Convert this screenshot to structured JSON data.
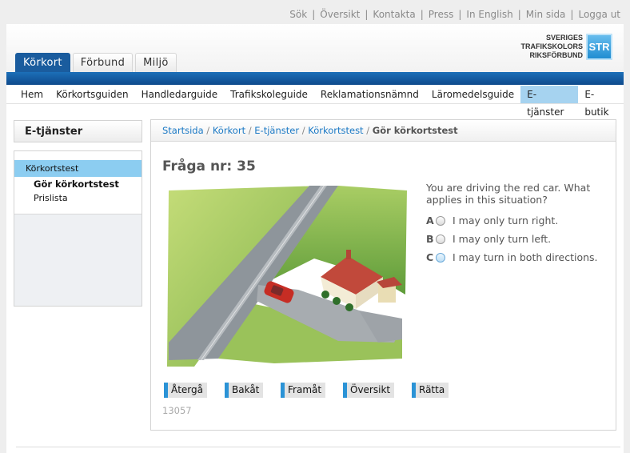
{
  "top_links": [
    "Sök",
    "Översikt",
    "Kontakta",
    "Press",
    "In English",
    "Min sida",
    "Logga ut"
  ],
  "logo": {
    "line1": "SVERIGES",
    "line2": "TRAFIKSKOLORS",
    "line3": "RIKSFÖRBUND",
    "badge": "STR"
  },
  "tabs": [
    {
      "label": "Körkort",
      "active": true
    },
    {
      "label": "Förbund",
      "active": false
    },
    {
      "label": "Miljö",
      "active": false
    }
  ],
  "subnav": [
    {
      "label": "Hem"
    },
    {
      "label": "Körkortsguiden"
    },
    {
      "label": "Handledarguide"
    },
    {
      "label": "Trafikskoleguide"
    },
    {
      "label": "Reklamationsnämnd"
    },
    {
      "label": "Läromedelsguide"
    },
    {
      "label": "E-tjänster",
      "active": true
    },
    {
      "label": "E-butik"
    }
  ],
  "sidebar": {
    "title": "E-tjänster",
    "active_item": "Körkortstest",
    "sub_items": [
      "Gör körkortstest",
      "Prislista"
    ]
  },
  "breadcrumb": {
    "items": [
      "Startsida",
      "Körkort",
      "E-tjänster",
      "Körkortstest"
    ],
    "separator": "/",
    "current": "Gör körkortstest"
  },
  "question": {
    "title": "Fråga nr: 35",
    "text": "You are driving the red car. What applies in this situation?",
    "options": [
      {
        "letter": "A",
        "text": "I may only turn right."
      },
      {
        "letter": "B",
        "text": "I may only turn left."
      },
      {
        "letter": "C",
        "text": "I may turn in both directions."
      }
    ]
  },
  "buttons": [
    "Återgå",
    "Bakåt",
    "Framåt",
    "Översikt",
    "Rätta"
  ],
  "code": "13057",
  "colors": {
    "brand_blue": "#1a5c9e",
    "active_light": "#8ccdf1",
    "link": "#1b79c5"
  }
}
